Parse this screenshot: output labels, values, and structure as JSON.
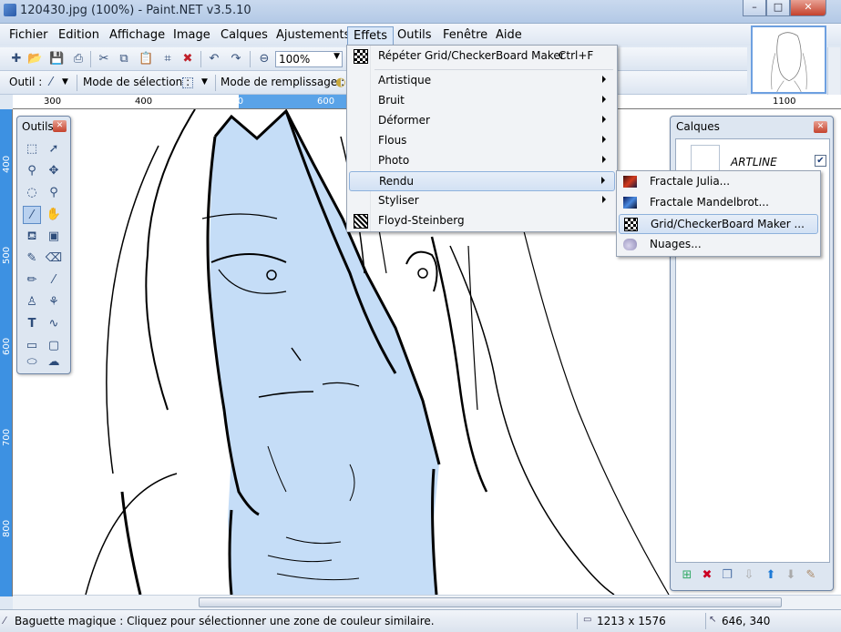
{
  "window": {
    "title": "120430.jpg (100%) - Paint.NET v3.5.10"
  },
  "menubar": {
    "items": [
      "Fichier",
      "Edition",
      "Affichage",
      "Image",
      "Calques",
      "Ajustements",
      "Effets",
      "Outils",
      "Fenêtre",
      "Aide"
    ]
  },
  "toolbar": {
    "zoom_value": "100%"
  },
  "toolbar2": {
    "tool_label": "Outil :",
    "selection_mode_label": "Mode de sélection :",
    "fill_mode_label": "Mode de remplissage :"
  },
  "ruler": {
    "top_labels": [
      "300",
      "400",
      "500",
      "600",
      "1100"
    ],
    "left_labels": [
      "400",
      "500",
      "600",
      "700",
      "800"
    ]
  },
  "tools_window": {
    "title": "Outils"
  },
  "layers_window": {
    "title": "Calques",
    "layer_name": "ARTLINE"
  },
  "effects_menu": {
    "repeat": {
      "label": "Répéter Grid/CheckerBoard Maker",
      "shortcut": "Ctrl+F"
    },
    "items": [
      "Artistique",
      "Bruit",
      "Déformer",
      "Flous",
      "Photo",
      "Rendu",
      "Styliser",
      "Floyd-Steinberg"
    ]
  },
  "render_submenu": {
    "items": [
      "Fractale Julia...",
      "Fractale Mandelbrot...",
      "Grid/CheckerBoard Maker ...",
      "Nuages..."
    ]
  },
  "status": {
    "hint": "Baguette magique : Cliquez pour sélectionner une zone de couleur similaire.",
    "image_size": "1213 x 1576",
    "cursor_pos": "646, 340"
  }
}
